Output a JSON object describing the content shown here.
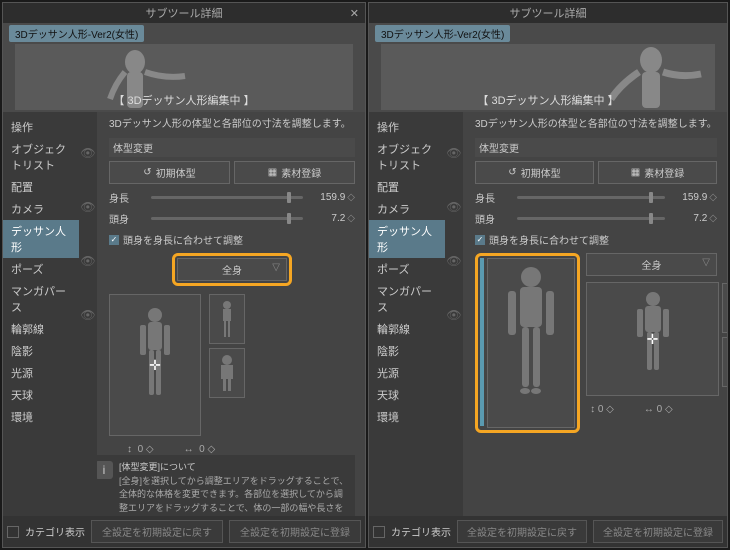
{
  "title": "サブツール詳細",
  "tag": "3Dデッサン人形-Ver2(女性)",
  "banner": "【 3Dデッサン人形編集中 】",
  "sidebar": [
    {
      "label": "操作"
    },
    {
      "label": "オブジェクトリスト"
    },
    {
      "label": "配置"
    },
    {
      "label": "カメラ"
    },
    {
      "label": "デッサン人形",
      "sel": true
    },
    {
      "label": "ポーズ"
    },
    {
      "label": "マンガパース"
    },
    {
      "label": "輪郭線"
    },
    {
      "label": "陰影"
    },
    {
      "label": "光源"
    },
    {
      "label": "天球"
    },
    {
      "label": "環境"
    }
  ],
  "desc1": "3Dデッサン人形の体型と各部位の寸法を調整します。",
  "desc2": "3Dデッサン人形の体型と各部位の寸法を調整します。",
  "section": "体型変更",
  "btn_reset": "初期体型",
  "btn_register": "素材登録",
  "height_label": "身長",
  "height_value": "159.9",
  "heads_label": "頭身",
  "heads_value": "7.2",
  "checkbox": "頭身を身長に合わせて調整",
  "dropdown": "全身",
  "slider_val": "0",
  "info_title": "[体型変更]について",
  "info_body": "[全身]を選択してから調整エリアをドラッグすることで、全体的な体格を変更できます。各部位を選択してから調整エリアをドラッグすることで、体の一部の幅や長さを変更できます。",
  "footer_cat": "カテゴリ表示",
  "footer_reset": "全設定を初期設定に戻す",
  "footer_save": "全設定を初期設定に登録"
}
